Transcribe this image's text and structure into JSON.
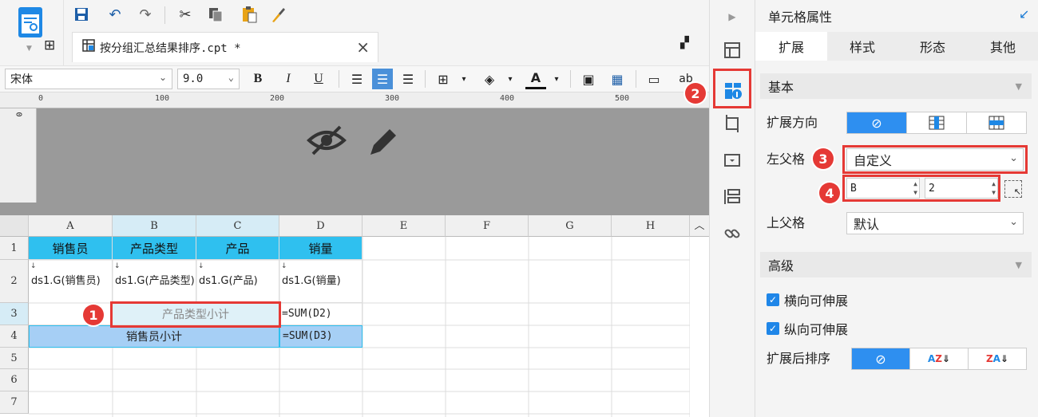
{
  "file_tab": {
    "label": "按分组汇总结果排序.cpt *"
  },
  "format_bar": {
    "font_name": "宋体",
    "font_size": "9.0"
  },
  "ruler": {
    "marks": [
      "0",
      "100",
      "200",
      "300",
      "400",
      "500"
    ]
  },
  "grid": {
    "columns": [
      "A",
      "B",
      "C",
      "D",
      "E",
      "F",
      "G",
      "H"
    ],
    "rows": [
      "1",
      "2",
      "3",
      "4",
      "5",
      "6",
      "7"
    ],
    "cells": {
      "a1": "销售员",
      "b1": "产品类型",
      "c1": "产品",
      "d1": "销量",
      "a2": "ds1.G(销售员)",
      "b2": "ds1.G(产品类型)",
      "c2": "ds1.G(产品)",
      "d2": "ds1.G(销量)",
      "b3": "产品类型小计",
      "d3": "=SUM(D2)",
      "b4": "销售员小计",
      "d4": "=SUM(D3)"
    }
  },
  "panel": {
    "title": "单元格属性",
    "tabs": [
      "扩展",
      "样式",
      "形态",
      "其他"
    ],
    "section_basic": "基本",
    "expand_direction_label": "扩展方向",
    "left_parent_label": "左父格",
    "left_parent_value": "自定义",
    "left_parent_col": "B",
    "left_parent_row": "2",
    "upper_parent_label": "上父格",
    "upper_parent_value": "默认",
    "section_advanced": "高级",
    "horizontal_extend": "横向可伸展",
    "vertical_extend": "纵向可伸展",
    "sort_label": "扩展后排序"
  },
  "annotations": [
    "1",
    "2",
    "3",
    "4"
  ],
  "colors": {
    "header_cell": "#2fc0ef",
    "selected_cell": "#a6cff5",
    "highlight": "#e53935",
    "accent": "#2e8ff0"
  }
}
